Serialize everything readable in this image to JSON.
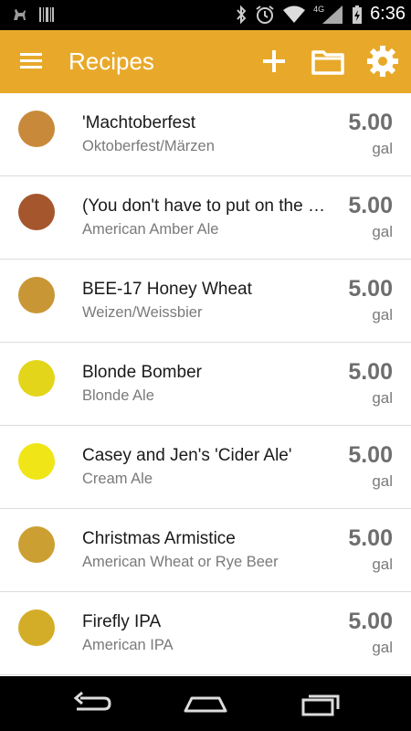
{
  "status_bar": {
    "time": "6:36",
    "network_label": "4G",
    "icons": [
      "app-notification-icon",
      "barcode-icon",
      "bluetooth-icon",
      "alarm-icon",
      "wifi-icon",
      "cell-signal-icon",
      "battery-charging-icon"
    ]
  },
  "app_bar": {
    "title": "Recipes",
    "icons": [
      "menu-icon",
      "add-icon",
      "folder-icon",
      "settings-icon"
    ],
    "background": "#e8a92a"
  },
  "recipes": [
    {
      "name": "'Machtoberfest",
      "style": "Oktoberfest/Märzen",
      "volume": "5.00",
      "unit": "gal",
      "color": "#c88a3a"
    },
    {
      "name": "(You don't have to put on the red light)",
      "style": "American Amber Ale",
      "volume": "5.00",
      "unit": "gal",
      "color": "#a5562c"
    },
    {
      "name": "BEE-17 Honey Wheat",
      "style": "Weizen/Weissbier",
      "volume": "5.00",
      "unit": "gal",
      "color": "#c99636"
    },
    {
      "name": "Blonde Bomber",
      "style": "Blonde Ale",
      "volume": "5.00",
      "unit": "gal",
      "color": "#e3d51a"
    },
    {
      "name": "Casey and Jen's 'Cider Ale'",
      "style": "Cream Ale",
      "volume": "5.00",
      "unit": "gal",
      "color": "#f0e517"
    },
    {
      "name": "Christmas Armistice",
      "style": "American Wheat or Rye Beer",
      "volume": "5.00",
      "unit": "gal",
      "color": "#cc9f33"
    },
    {
      "name": "Firefly IPA",
      "style": "American IPA",
      "volume": "5.00",
      "unit": "gal",
      "color": "#d4ad28"
    }
  ],
  "nav_bar": {
    "icons": [
      "back-icon",
      "home-icon",
      "recents-icon"
    ]
  }
}
